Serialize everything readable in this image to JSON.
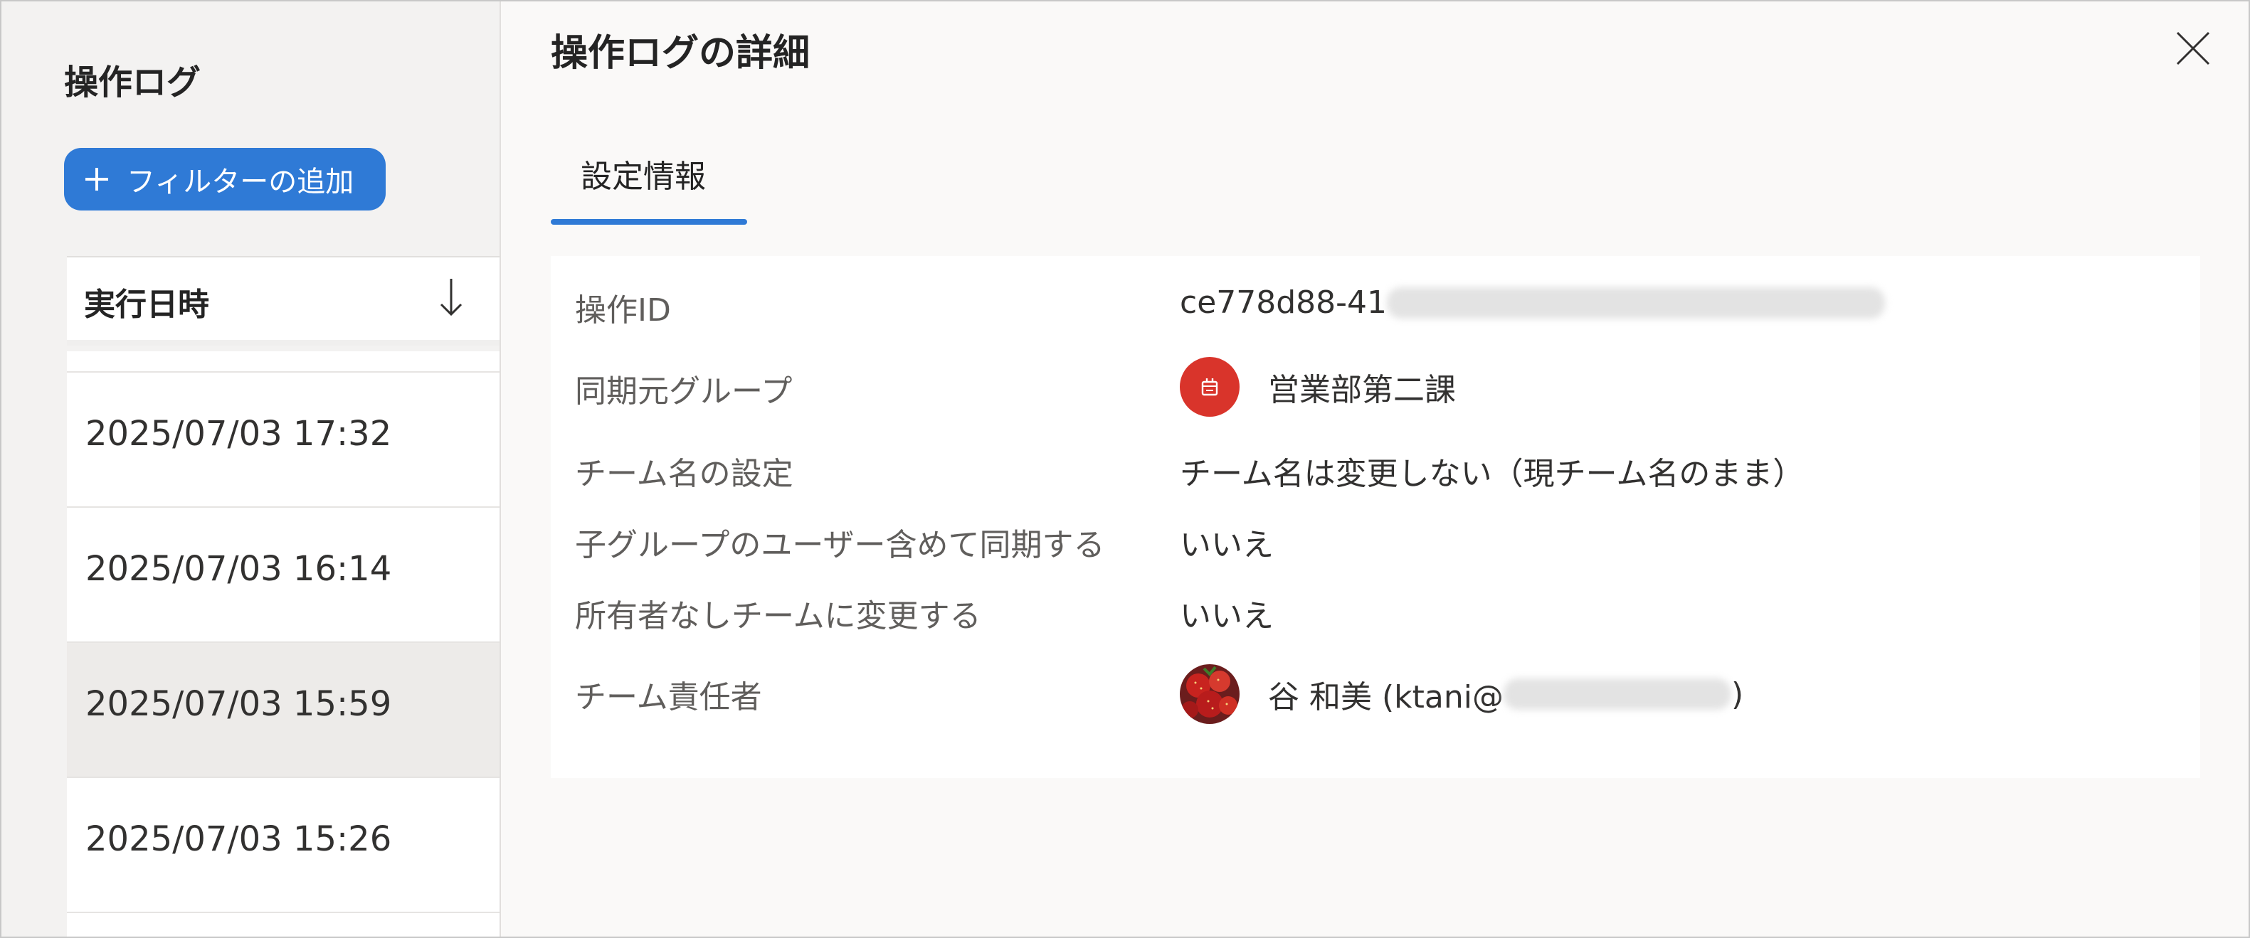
{
  "sidebar": {
    "title": "操作ログ",
    "filter_button_label": "フィルターの追加",
    "list_header": "実行日時",
    "rows": [
      {
        "datetime": "2025/07/03 17:32"
      },
      {
        "datetime": "2025/07/03 16:14"
      },
      {
        "datetime": "2025/07/03 15:59",
        "selected": true
      },
      {
        "datetime": "2025/07/03 15:26"
      }
    ]
  },
  "detail": {
    "title": "操作ログの詳細",
    "tabs": [
      {
        "label": "設定情報"
      }
    ],
    "fields": [
      {
        "label": "操作ID",
        "value": "ce778d88-41"
      },
      {
        "label": "同期元グループ",
        "value": "営業部第二課"
      },
      {
        "label": "チーム名の設定",
        "value": "チーム名は変更しない（現チーム名のまま）"
      },
      {
        "label": "子グループのユーザー含めて同期する",
        "value": "いいえ"
      },
      {
        "label": "所有者なしチームに変更する",
        "value": "いいえ"
      },
      {
        "label": "チーム責任者",
        "value_prefix": "谷 和美 (ktani@",
        "value_suffix": ")"
      }
    ]
  },
  "icons": {
    "add": "plus-icon",
    "sort": "arrow-down-icon",
    "close": "close-icon",
    "group": "group-avatar-icon",
    "user": "user-avatar-strawberry"
  },
  "colors": {
    "accent": "#2f7ad6",
    "group_avatar": "#d9342b",
    "selected_row": "#edebe9"
  }
}
